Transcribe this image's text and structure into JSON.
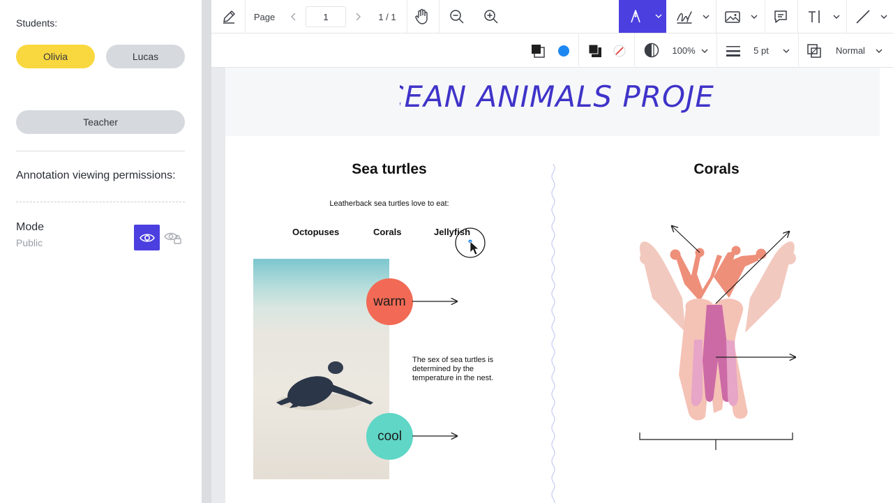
{
  "sidebar": {
    "students_label": "Students:",
    "students": [
      {
        "name": "Olivia",
        "selected": true,
        "color": "#f9d83f"
      },
      {
        "name": "Lucas",
        "selected": false,
        "color": "#d6d9de"
      }
    ],
    "teacher_label": "Teacher",
    "permissions_label": "Annotation viewing permissions:",
    "mode_label": "Mode",
    "mode_value": "Public",
    "mode_options": [
      {
        "icon": "eye-icon",
        "active": true
      },
      {
        "icon": "eye-lock-icon",
        "active": false
      }
    ]
  },
  "toolbar": {
    "page_label": "Page",
    "page_value": "1",
    "page_count": "1 / 1",
    "zoom": "100%",
    "stroke_width": "5 pt",
    "blend_mode": "Normal",
    "accent": "#4b3fe0",
    "stroke_color": "#1e88f2",
    "fill_color": "#1f1f1f"
  },
  "document": {
    "title": "OCEAN ANIMALS PROJECT",
    "left": {
      "heading": "Sea turtles",
      "intro": "Leatherback sea turtles love to eat:",
      "foods": [
        "Octopuses",
        "Corals",
        "Jellyfish"
      ],
      "warm_label": "warm",
      "cool_label": "cool",
      "sex_fact": "The sex of sea turtles is determined by the temperature in the nest."
    },
    "right": {
      "heading": "Corals"
    }
  }
}
